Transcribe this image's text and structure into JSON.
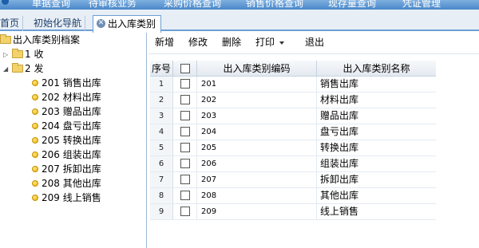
{
  "menubar": {
    "items": [
      "单据查询",
      "待审核业务",
      "采购价格查询",
      "销售价格查询",
      "现存量查询",
      "凭证管理"
    ]
  },
  "tabs": [
    {
      "label": "首页"
    },
    {
      "label": "初始化导航"
    },
    {
      "label": "出入库类别",
      "active": true
    }
  ],
  "tree": {
    "root": "出入库类别档案",
    "groups": [
      {
        "label": "1 收",
        "expanded": false
      },
      {
        "label": "2 发",
        "expanded": true
      }
    ],
    "leaves": [
      "201 销售出库",
      "202 材料出库",
      "203 赠品出库",
      "204 盘亏出库",
      "205 转换出库",
      "206 组装出库",
      "207 拆卸出库",
      "208 其他出库",
      "209 线上销售"
    ]
  },
  "toolbar": {
    "add": "新增",
    "edit": "修改",
    "delete": "删除",
    "print": "打印",
    "exit": "退出"
  },
  "grid": {
    "columns": [
      "序号",
      "",
      "出入库类别编码",
      "出入库类别名称"
    ],
    "rows": [
      {
        "no": "1",
        "code": "201",
        "name": "销售出库"
      },
      {
        "no": "2",
        "code": "202",
        "name": "材料出库"
      },
      {
        "no": "3",
        "code": "203",
        "name": "赠品出库"
      },
      {
        "no": "4",
        "code": "204",
        "name": "盘亏出库"
      },
      {
        "no": "5",
        "code": "205",
        "name": "转换出库"
      },
      {
        "no": "6",
        "code": "206",
        "name": "组装出库"
      },
      {
        "no": "7",
        "code": "207",
        "name": "拆卸出库"
      },
      {
        "no": "8",
        "code": "208",
        "name": "其他出库"
      },
      {
        "no": "9",
        "code": "209",
        "name": "线上销售"
      }
    ]
  },
  "colors": {
    "accent": "#6a9fd4",
    "menubar": "#4a87c9",
    "leaf": "#e8b000",
    "folder": "#f3d26b"
  }
}
